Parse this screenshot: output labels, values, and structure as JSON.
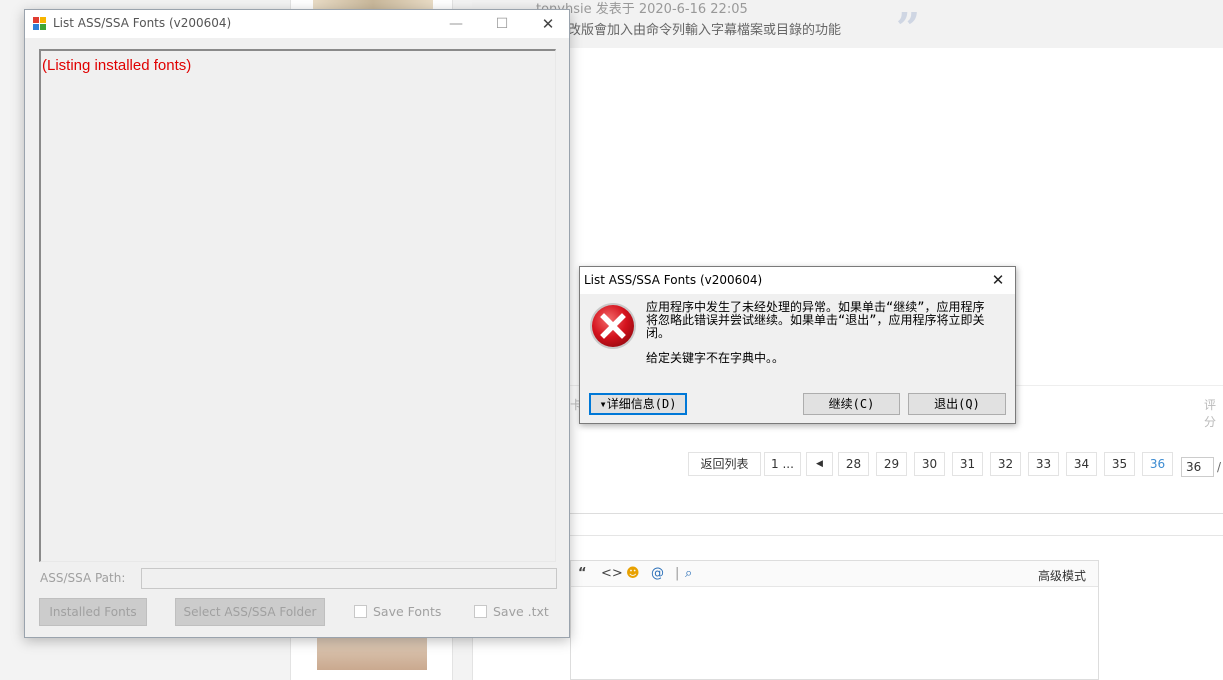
{
  "background": {
    "quote_author": "tonyhsie 发表于 2020-6-16 22:05",
    "quote_text": "改版會加入由命令列輸入字幕檔案或目錄的功能",
    "quote_mark": "”",
    "left_fragment": "卡",
    "right_fragment": "评分",
    "pager": {
      "back_label": "返回列表",
      "first_label": "1 ...",
      "prev_icon": "◀",
      "pages": [
        "28",
        "29",
        "30",
        "31",
        "32",
        "33",
        "34",
        "35",
        "36"
      ],
      "current_page": "36",
      "page_input_value": "36",
      "slash": "/"
    },
    "editor": {
      "icons": [
        "quote-icon",
        "code-icon",
        "emoji-icon",
        "at-icon",
        "attachment-icon"
      ],
      "advanced_mode_label": "高级模式"
    }
  },
  "app_window": {
    "title": "List ASS/SSA Fonts (v200604)",
    "list_status_text": "(Listing installed fonts)",
    "path_label": "ASS/SSA Path:",
    "path_value": "",
    "installed_fonts_button": "Installed Fonts",
    "select_folder_button": "Select ASS/SSA Folder",
    "save_fonts_label": "Save Fonts",
    "save_txt_label": "Save .txt",
    "save_fonts_checked": false,
    "save_txt_checked": false
  },
  "error_dialog": {
    "title": "List ASS/SSA Fonts (v200604)",
    "message": "应用程序中发生了未经处理的异常。如果单击“继续”，应用程序将忽略此错误并尝试继续。如果单击“退出”，应用程序将立即关闭。",
    "detail_message": "给定关键字不在字典中。。",
    "details_button": "▾详细信息(D)",
    "continue_button": "继续(C)",
    "quit_button": "退出(Q)",
    "icon": "error-icon",
    "icon_color": "#d4121d"
  }
}
